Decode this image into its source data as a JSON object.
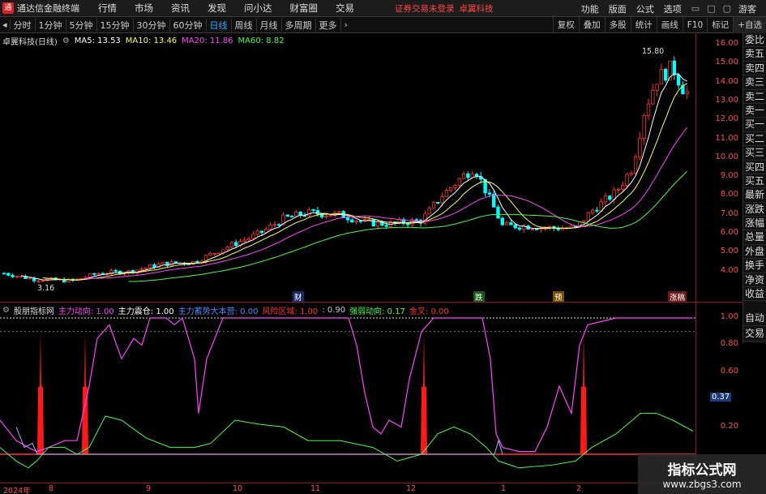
{
  "menubar": {
    "app_title": "通达信金融终端",
    "items": [
      "行情",
      "市场",
      "资讯",
      "发现",
      "问小达",
      "财富圈",
      "交易"
    ],
    "login_warning": "证券交易未登录",
    "brand": "卓翼科技",
    "right_items": [
      "功能",
      "版面",
      "公式",
      "选项"
    ],
    "user": "游客"
  },
  "toolbar": {
    "periods": [
      "分时",
      "1分钟",
      "5分钟",
      "15分钟",
      "30分钟",
      "60分钟",
      "日线",
      "周线",
      "月线",
      "多周期",
      "更多"
    ],
    "active_period": "日线",
    "right_buttons": [
      "复权",
      "叠加",
      "多股",
      "统计",
      "画线",
      "F10",
      "标记",
      "+自选"
    ]
  },
  "main_chart": {
    "title": "卓翼科技(日线)",
    "ma": [
      {
        "label": "MA5: 13.53",
        "color": "#ffffff"
      },
      {
        "label": "MA10: 13.46",
        "color": "#ffff55"
      },
      {
        "label": "MA20: 11.86",
        "color": "#ff44ff"
      },
      {
        "label": "MA60: 8.82",
        "color": "#44ff44"
      }
    ],
    "high_marker": "15.80",
    "low_marker": "3.16",
    "events": [
      {
        "label": "财",
        "color": "#3a6aff"
      },
      {
        "label": "跌",
        "color": "#22aa22"
      },
      {
        "label": "预",
        "color": "#cc8800"
      },
      {
        "label": "涨稿",
        "color": "#ff6666"
      }
    ]
  },
  "price_axis": [
    "16.00",
    "15.00",
    "14.00",
    "13.00",
    "12.00",
    "11.00",
    "10.00",
    "9.00",
    "8.00",
    "7.00",
    "6.00",
    "5.00",
    "4.00"
  ],
  "side_tabs": [
    "委比",
    "卖五",
    "卖四",
    "卖三",
    "卖二",
    "卖一",
    "买一",
    "买二",
    "买三",
    "买四",
    "买五",
    "最新",
    "涨跌",
    "涨幅",
    "总量",
    "外盘",
    "换手",
    "净资",
    "收益"
  ],
  "side_tabs2": [
    "自动",
    "交易"
  ],
  "indicator": {
    "name": "股朋指标网",
    "items": [
      {
        "label": "主力动向: 1.00",
        "color": "#ff44ff"
      },
      {
        "label": "主力震仓: 1.00",
        "color": "#ffffff"
      },
      {
        "label": "主力蓄势大本营: 0.00",
        "color": "#4d8cff"
      },
      {
        "label": "风险区域: 1.00",
        "color": "#ff3333"
      },
      {
        "label": ": 0.90",
        "color": "#cccccc"
      },
      {
        "label": "强弱动向: 0.17",
        "color": "#44ff44"
      },
      {
        "label": "金叉: 0.00",
        "color": "#ff3333"
      }
    ],
    "axis": [
      "1.00",
      "0.80",
      "0.60",
      "0.37",
      "0.20"
    ],
    "current_value": "0.37"
  },
  "date_axis": [
    "2024年",
    "8",
    "9",
    "10",
    "11",
    "12",
    "1",
    "2"
  ],
  "watermark": {
    "title": "指标公式网",
    "url": "www.zbgs3.com"
  },
  "colors": {
    "up": "#ff3333",
    "down": "#00ffff",
    "axis": "#ff4d4d",
    "frame": "#8b1a1a"
  }
}
